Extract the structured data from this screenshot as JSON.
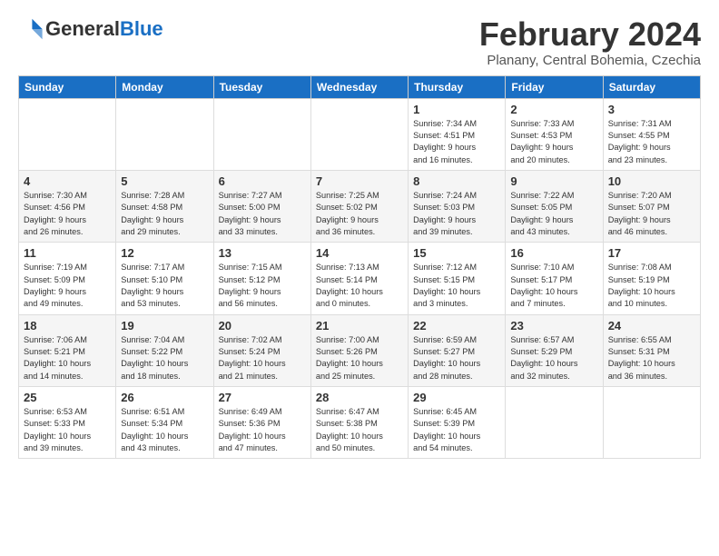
{
  "logo": {
    "line1": "General",
    "line2": "Blue"
  },
  "title": "February 2024",
  "location": "Planany, Central Bohemia, Czechia",
  "days_header": [
    "Sunday",
    "Monday",
    "Tuesday",
    "Wednesday",
    "Thursday",
    "Friday",
    "Saturday"
  ],
  "weeks": [
    [
      {
        "num": "",
        "info": ""
      },
      {
        "num": "",
        "info": ""
      },
      {
        "num": "",
        "info": ""
      },
      {
        "num": "",
        "info": ""
      },
      {
        "num": "1",
        "info": "Sunrise: 7:34 AM\nSunset: 4:51 PM\nDaylight: 9 hours\nand 16 minutes."
      },
      {
        "num": "2",
        "info": "Sunrise: 7:33 AM\nSunset: 4:53 PM\nDaylight: 9 hours\nand 20 minutes."
      },
      {
        "num": "3",
        "info": "Sunrise: 7:31 AM\nSunset: 4:55 PM\nDaylight: 9 hours\nand 23 minutes."
      }
    ],
    [
      {
        "num": "4",
        "info": "Sunrise: 7:30 AM\nSunset: 4:56 PM\nDaylight: 9 hours\nand 26 minutes."
      },
      {
        "num": "5",
        "info": "Sunrise: 7:28 AM\nSunset: 4:58 PM\nDaylight: 9 hours\nand 29 minutes."
      },
      {
        "num": "6",
        "info": "Sunrise: 7:27 AM\nSunset: 5:00 PM\nDaylight: 9 hours\nand 33 minutes."
      },
      {
        "num": "7",
        "info": "Sunrise: 7:25 AM\nSunset: 5:02 PM\nDaylight: 9 hours\nand 36 minutes."
      },
      {
        "num": "8",
        "info": "Sunrise: 7:24 AM\nSunset: 5:03 PM\nDaylight: 9 hours\nand 39 minutes."
      },
      {
        "num": "9",
        "info": "Sunrise: 7:22 AM\nSunset: 5:05 PM\nDaylight: 9 hours\nand 43 minutes."
      },
      {
        "num": "10",
        "info": "Sunrise: 7:20 AM\nSunset: 5:07 PM\nDaylight: 9 hours\nand 46 minutes."
      }
    ],
    [
      {
        "num": "11",
        "info": "Sunrise: 7:19 AM\nSunset: 5:09 PM\nDaylight: 9 hours\nand 49 minutes."
      },
      {
        "num": "12",
        "info": "Sunrise: 7:17 AM\nSunset: 5:10 PM\nDaylight: 9 hours\nand 53 minutes."
      },
      {
        "num": "13",
        "info": "Sunrise: 7:15 AM\nSunset: 5:12 PM\nDaylight: 9 hours\nand 56 minutes."
      },
      {
        "num": "14",
        "info": "Sunrise: 7:13 AM\nSunset: 5:14 PM\nDaylight: 10 hours\nand 0 minutes."
      },
      {
        "num": "15",
        "info": "Sunrise: 7:12 AM\nSunset: 5:15 PM\nDaylight: 10 hours\nand 3 minutes."
      },
      {
        "num": "16",
        "info": "Sunrise: 7:10 AM\nSunset: 5:17 PM\nDaylight: 10 hours\nand 7 minutes."
      },
      {
        "num": "17",
        "info": "Sunrise: 7:08 AM\nSunset: 5:19 PM\nDaylight: 10 hours\nand 10 minutes."
      }
    ],
    [
      {
        "num": "18",
        "info": "Sunrise: 7:06 AM\nSunset: 5:21 PM\nDaylight: 10 hours\nand 14 minutes."
      },
      {
        "num": "19",
        "info": "Sunrise: 7:04 AM\nSunset: 5:22 PM\nDaylight: 10 hours\nand 18 minutes."
      },
      {
        "num": "20",
        "info": "Sunrise: 7:02 AM\nSunset: 5:24 PM\nDaylight: 10 hours\nand 21 minutes."
      },
      {
        "num": "21",
        "info": "Sunrise: 7:00 AM\nSunset: 5:26 PM\nDaylight: 10 hours\nand 25 minutes."
      },
      {
        "num": "22",
        "info": "Sunrise: 6:59 AM\nSunset: 5:27 PM\nDaylight: 10 hours\nand 28 minutes."
      },
      {
        "num": "23",
        "info": "Sunrise: 6:57 AM\nSunset: 5:29 PM\nDaylight: 10 hours\nand 32 minutes."
      },
      {
        "num": "24",
        "info": "Sunrise: 6:55 AM\nSunset: 5:31 PM\nDaylight: 10 hours\nand 36 minutes."
      }
    ],
    [
      {
        "num": "25",
        "info": "Sunrise: 6:53 AM\nSunset: 5:33 PM\nDaylight: 10 hours\nand 39 minutes."
      },
      {
        "num": "26",
        "info": "Sunrise: 6:51 AM\nSunset: 5:34 PM\nDaylight: 10 hours\nand 43 minutes."
      },
      {
        "num": "27",
        "info": "Sunrise: 6:49 AM\nSunset: 5:36 PM\nDaylight: 10 hours\nand 47 minutes."
      },
      {
        "num": "28",
        "info": "Sunrise: 6:47 AM\nSunset: 5:38 PM\nDaylight: 10 hours\nand 50 minutes."
      },
      {
        "num": "29",
        "info": "Sunrise: 6:45 AM\nSunset: 5:39 PM\nDaylight: 10 hours\nand 54 minutes."
      },
      {
        "num": "",
        "info": ""
      },
      {
        "num": "",
        "info": ""
      }
    ]
  ]
}
